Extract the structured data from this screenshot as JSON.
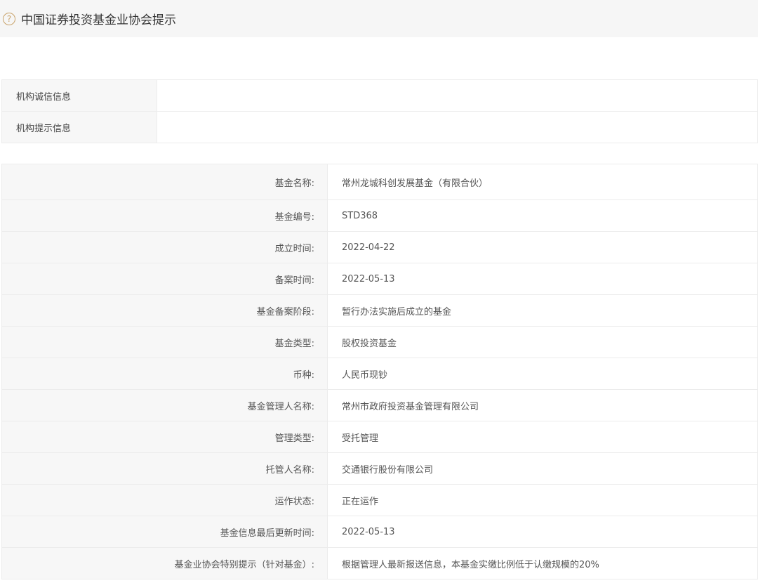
{
  "header": {
    "icon": "question-circle-icon",
    "title": "中国证券投资基金业协会提示"
  },
  "institution": [
    {
      "label": "机构诚信信息",
      "value": ""
    },
    {
      "label": "机构提示信息",
      "value": ""
    }
  ],
  "fund": [
    {
      "label": "基金名称:",
      "value": "常州龙城科创发展基金（有限合伙）"
    },
    {
      "label": "基金编号:",
      "value": "STD368"
    },
    {
      "label": "成立时间:",
      "value": "2022-04-22"
    },
    {
      "label": "备案时间:",
      "value": "2022-05-13"
    },
    {
      "label": "基金备案阶段:",
      "value": "暂行办法实施后成立的基金"
    },
    {
      "label": "基金类型:",
      "value": "股权投资基金"
    },
    {
      "label": "币种:",
      "value": "人民币现钞"
    },
    {
      "label": "基金管理人名称:",
      "value": "常州市政府投资基金管理有限公司"
    },
    {
      "label": "管理类型:",
      "value": "受托管理"
    },
    {
      "label": "托管人名称:",
      "value": "交通银行股份有限公司"
    },
    {
      "label": "运作状态:",
      "value": "正在运作"
    },
    {
      "label": "基金信息最后更新时间:",
      "value": "2022-05-13"
    },
    {
      "label": "基金业协会特别提示（针对基金）:",
      "value": "根据管理人最新报送信息，本基金实缴比例低于认缴规模的20%"
    }
  ]
}
